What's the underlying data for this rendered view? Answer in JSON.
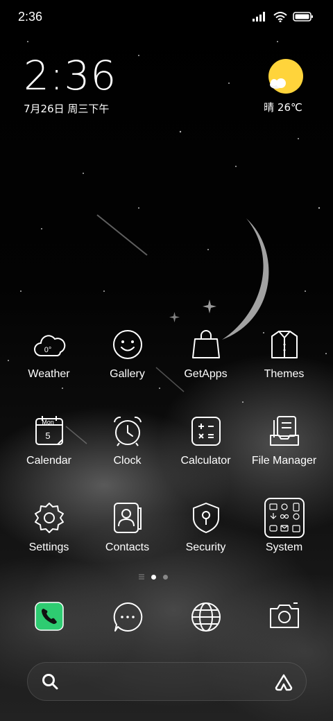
{
  "status_bar": {
    "time": "2:36"
  },
  "clock_widget": {
    "time": "2:36",
    "date": "7月26日 周三下午"
  },
  "weather_widget": {
    "condition_temp": "晴 26℃",
    "icon": "sunny-cloud-icon"
  },
  "weather_app_icon_text": "0°",
  "calendar_icon_text": {
    "day": "Mon",
    "date": "5"
  },
  "apps": [
    {
      "label": "Weather",
      "icon": "weather-icon"
    },
    {
      "label": "Gallery",
      "icon": "gallery-icon"
    },
    {
      "label": "GetApps",
      "icon": "getapps-icon"
    },
    {
      "label": "Themes",
      "icon": "themes-icon"
    },
    {
      "label": "Calendar",
      "icon": "calendar-icon"
    },
    {
      "label": "Clock",
      "icon": "clock-icon"
    },
    {
      "label": "Calculator",
      "icon": "calculator-icon"
    },
    {
      "label": "File Manager",
      "icon": "file-manager-icon"
    },
    {
      "label": "Settings",
      "icon": "settings-icon"
    },
    {
      "label": "Contacts",
      "icon": "contacts-icon"
    },
    {
      "label": "Security",
      "icon": "security-icon"
    },
    {
      "label": "System",
      "icon": "system-folder-icon"
    }
  ],
  "dock": [
    {
      "icon": "phone-icon"
    },
    {
      "icon": "messaging-icon"
    },
    {
      "icon": "browser-icon"
    },
    {
      "icon": "camera-icon"
    }
  ],
  "pager": {
    "page_count": 2,
    "current_page": 1
  },
  "colors": {
    "sun": "#ffd43b",
    "phone_green": "#2ecc71",
    "active_dot": "#ffffff",
    "inactive_dot": "#888888"
  }
}
